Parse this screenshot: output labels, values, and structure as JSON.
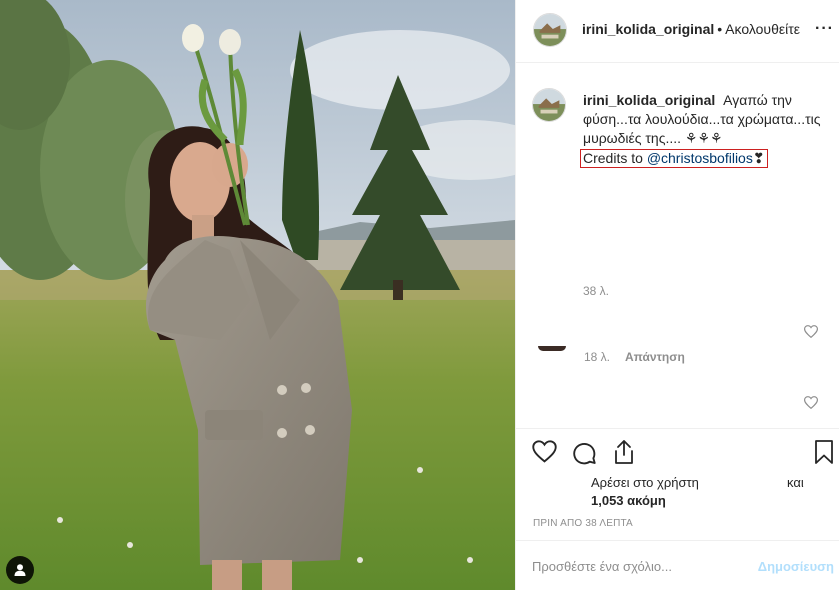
{
  "post": {
    "username": "irini_kolida_original",
    "separator": "•",
    "follow_label": "Ακολουθείτε",
    "more_label": "···",
    "caption_text": "Αγαπώ την φύση...τα λουλούδια...τα χρώματα...τις μυρωδιές της.... ⚘⚘⚘",
    "credits_prefix": "Credits to ",
    "credits_mention": "@christosbofilios",
    "credits_suffix": "❣",
    "caption_time": "38 λ.",
    "comment_time": "18 λ.",
    "reply_label": "Απάντηση",
    "likes_text": "Αρέσει στο χρήστη",
    "likes_and": "και",
    "likes_count": "1,053 ακόμη",
    "timestamp": "ΠΡΙΝ ΑΠΟ 38 ΛΕΠΤΑ",
    "comment_placeholder": "Προσθέστε ένα σχόλιο...",
    "post_button": "Δημοσίευση"
  },
  "icons": {
    "like": "heart-icon",
    "comment": "comment-icon",
    "share": "share-icon",
    "save": "bookmark-icon",
    "tag": "user-tag-icon"
  },
  "colors": {
    "text": "#262626",
    "secondary": "#8e8e8e",
    "link": "#00376b",
    "post_button_disabled": "#b2dffc",
    "highlight_box": "#cc2020"
  }
}
